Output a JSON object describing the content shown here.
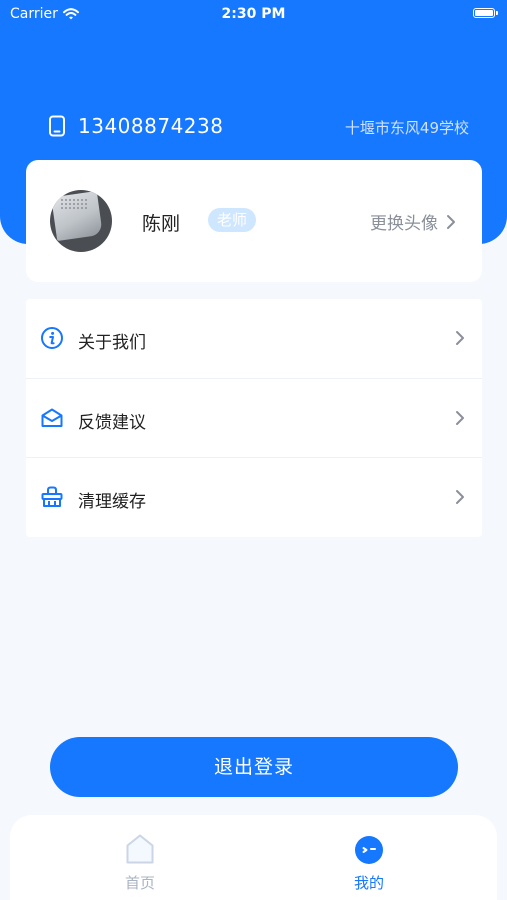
{
  "status_bar": {
    "carrier": "Carrier",
    "time": "2:30 PM"
  },
  "header": {
    "phone": "13408874238",
    "school": "十堰市东风49学校"
  },
  "profile": {
    "name": "陈刚",
    "role": "老师",
    "change_avatar": "更换头像"
  },
  "menu": {
    "items": [
      {
        "label": "关于我们",
        "icon": "info-icon"
      },
      {
        "label": "反馈建议",
        "icon": "mail-icon"
      },
      {
        "label": "清理缓存",
        "icon": "basket-icon"
      }
    ]
  },
  "logout": {
    "label": "退出登录"
  },
  "tabbar": {
    "tabs": [
      {
        "label": "首页",
        "icon": "home-icon",
        "active": false
      },
      {
        "label": "我的",
        "icon": "profile-icon",
        "active": true
      }
    ]
  },
  "colors": {
    "primary": "#1677ff",
    "inactive": "#a9b3c4",
    "page_bg": "#f5f8fd"
  }
}
